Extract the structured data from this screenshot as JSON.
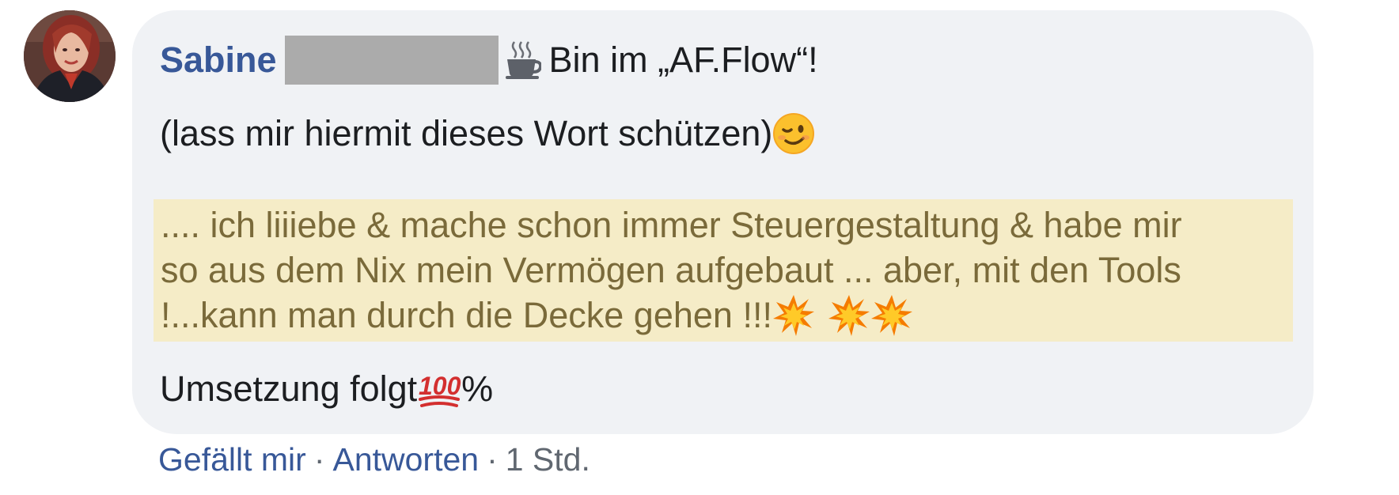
{
  "comment": {
    "author": "Sabine",
    "header_text": "Bin im „AF.Flow“!",
    "line2": "(lass mir hiermit dieses Wort schützen)",
    "quote_line1": ".... ich liiiebe & mache schon immer Steuergestaltung & habe mir",
    "quote_line2": "so aus dem Nix mein Vermögen aufgebaut ... aber, mit den Tools",
    "quote_line3": "!...kann man durch die Decke gehen !!!",
    "line4_text": "Umsetzung folgt",
    "line4_suffix": "%",
    "highlight_color": "#f5ecc7",
    "author_color": "#385898"
  },
  "icons": {
    "cup": "hot-beverage-icon",
    "wink": "winking-face-icon",
    "burst": "collision-icon",
    "hundred": "hundred-points-icon"
  },
  "actions": {
    "like": "Gefällt mir",
    "reply": "Antworten",
    "separator": "·",
    "time": "1 Std."
  }
}
